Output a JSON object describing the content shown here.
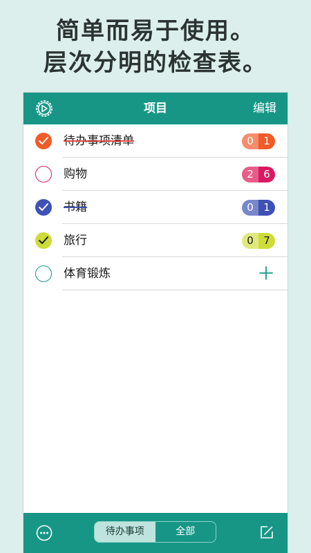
{
  "headline": {
    "line1": "简单而易于使用。",
    "line2": "层次分明的检查表。"
  },
  "navbar": {
    "settings_icon": "gear-icon",
    "title": "项目",
    "edit_label": "编辑"
  },
  "items": [
    {
      "label": "待办事项清单",
      "done": true,
      "left": "0",
      "right": "1",
      "color": "#f15a29",
      "color_light": "#f78c6b",
      "strike_color": "#e2483d"
    },
    {
      "label": "购物",
      "done": false,
      "left": "2",
      "right": "6",
      "color": "#d81b60",
      "color_light": "#ea5b8a"
    },
    {
      "label": "书籍",
      "done": true,
      "left": "0",
      "right": "1",
      "color": "#3f51b5",
      "color_light": "#7886cb",
      "strike_color": "#3f51b5"
    },
    {
      "label": "旅行",
      "done": true,
      "left": "0",
      "right": "7",
      "color": "#cddc39",
      "color_light": "#dfe97e"
    },
    {
      "label": "体育锻炼",
      "done": false,
      "add_icon": "plus-icon",
      "color": "#179686"
    }
  ],
  "toolbar": {
    "more_icon": "ellipsis-circle-icon",
    "segment_todo": "待办事项",
    "segment_all": "全部",
    "compose_icon": "compose-icon"
  },
  "colors": {
    "accent": "#179686",
    "background": "#dcefec"
  }
}
